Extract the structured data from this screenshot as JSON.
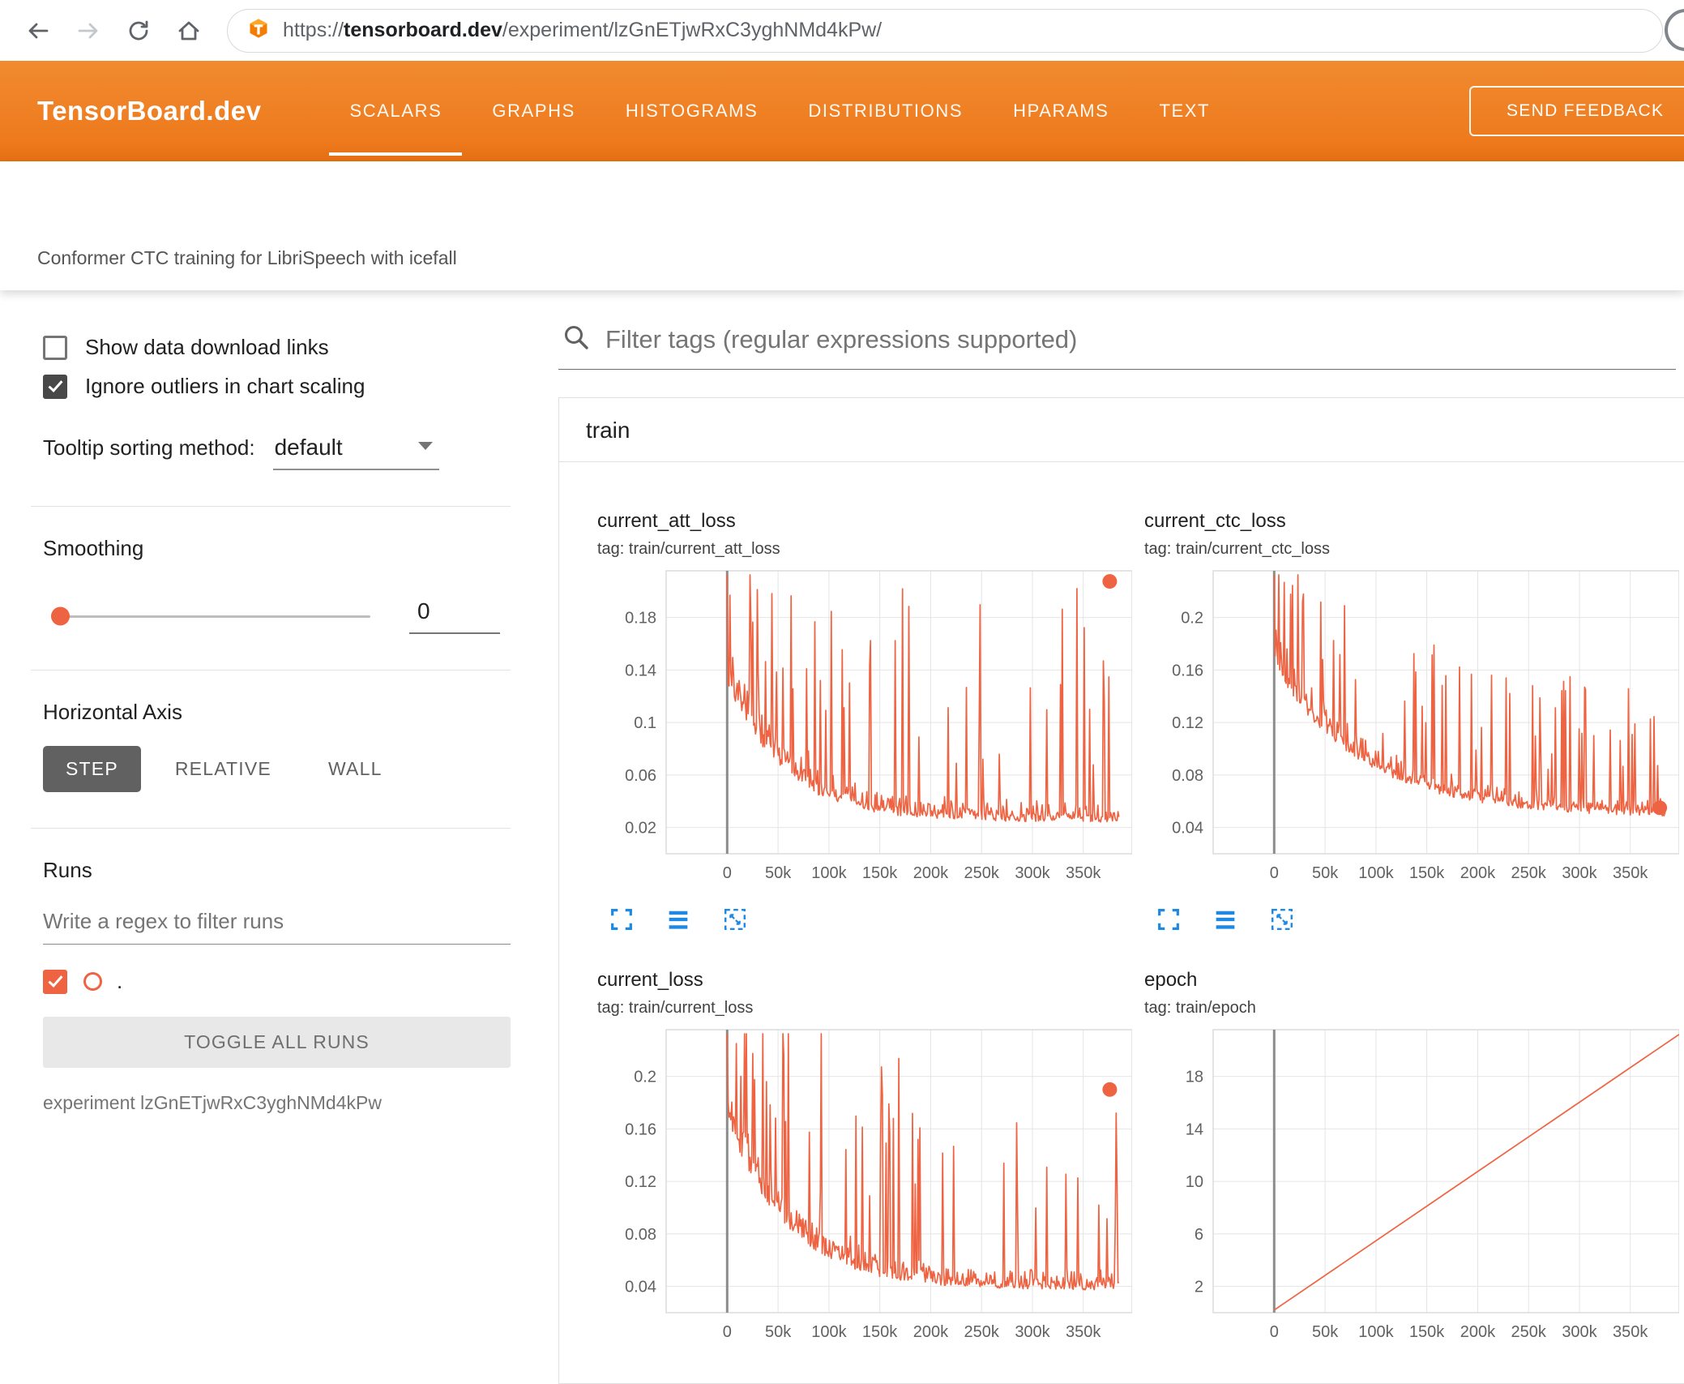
{
  "browser": {
    "url_scheme": "https://",
    "url_domain": "tensorboard.dev",
    "url_path": "/experiment/lzGnETjwRxC3yghNMd4kPw/"
  },
  "header": {
    "brand": "TensorBoard.dev",
    "tabs": [
      {
        "label": "SCALARS",
        "active": true
      },
      {
        "label": "GRAPHS",
        "active": false
      },
      {
        "label": "HISTOGRAMS",
        "active": false
      },
      {
        "label": "DISTRIBUTIONS",
        "active": false
      },
      {
        "label": "HPARAMS",
        "active": false
      },
      {
        "label": "TEXT",
        "active": false
      }
    ],
    "feedback_button": "SEND FEEDBACK"
  },
  "subheader": {
    "title": "Conformer CTC training for LibriSpeech with icefall"
  },
  "sidebar": {
    "checkboxes": [
      {
        "label": "Show data download links",
        "checked": false
      },
      {
        "label": "Ignore outliers in chart scaling",
        "checked": true
      }
    ],
    "tooltip_sorting": {
      "label": "Tooltip sorting method:",
      "value": "default"
    },
    "smoothing": {
      "label": "Smoothing",
      "value": "0"
    },
    "horizontal_axis": {
      "label": "Horizontal Axis",
      "options": [
        {
          "label": "STEP",
          "active": true
        },
        {
          "label": "RELATIVE",
          "active": false
        },
        {
          "label": "WALL",
          "active": false
        }
      ]
    },
    "runs": {
      "label": "Runs",
      "filter_placeholder": "Write a regex to filter runs",
      "run_item": {
        "name": ".",
        "checked": true
      },
      "toggle_button": "TOGGLE ALL RUNS",
      "experiment_label": "experiment lzGnETjwRxC3yghNMd4kPw"
    }
  },
  "main": {
    "filter_placeholder": "Filter tags (regular expressions supported)",
    "card_title": "train"
  },
  "colors": {
    "header_orange": "#ee7a1d",
    "header_orange_dark": "#e56f12",
    "run_color": "#ee6443",
    "icon_blue": "#1e88e5",
    "step_button_gray": "#616161"
  },
  "icons": {
    "back-icon": "left-arrow",
    "forward-icon": "right-arrow",
    "reload-icon": "circular-arrow",
    "home-icon": "house",
    "tensorboard-favicon-icon": "orange-cube-logo",
    "search-icon": "magnifier",
    "chevron-down-icon": "▾",
    "fullscreen-icon": "corner-brackets",
    "log-scale-icon": "three-lines",
    "fit-domain-icon": "dashed-box-arrows",
    "avatar": "partial-circle"
  },
  "chart_data": [
    {
      "id": "current_att_loss",
      "type": "line",
      "title": "current_att_loss",
      "subtitle": "tag: train/current_att_loss",
      "x_range": [
        -60000,
        398000
      ],
      "y_range": [
        0,
        0.2156
      ],
      "x_tick_values": [
        0,
        50000,
        100000,
        150000,
        200000,
        250000,
        300000,
        350000
      ],
      "x_tick_labels": [
        "0",
        "50k",
        "100k",
        "150k",
        "200k",
        "250k",
        "300k",
        "350k"
      ],
      "y_ticks": [
        0.02,
        0.06,
        0.1,
        0.14,
        0.18
      ],
      "y_tick_labels": [
        "0.02",
        "0.06",
        "0.1",
        "0.14",
        "0.18"
      ],
      "grid": true,
      "legend": "none",
      "toolbar": true,
      "series": [
        {
          "name": ".",
          "approx_trend": [
            [
              0,
              0.19
            ],
            [
              20000,
              0.13
            ],
            [
              50000,
              0.06
            ],
            [
              100000,
              0.04
            ],
            [
              150000,
              0.033
            ],
            [
              200000,
              0.03
            ],
            [
              250000,
              0.029
            ],
            [
              300000,
              0.028
            ],
            [
              380000,
              0.027
            ]
          ],
          "end_marker": [
            376000,
            0.2075
          ],
          "synthesis": {
            "seed": 11,
            "n": 430,
            "x0": 0,
            "x1": 385000,
            "base_start": 0.13,
            "base_end": 0.024,
            "base_tau": 55000,
            "noise_start": 0.05,
            "noise_end": 0.018,
            "noise_tau": 90000,
            "spike_prob": 0.1,
            "spike_boost": 2.0,
            "spike_min": 0.04,
            "spike_max": 0.17,
            "clip_min": 0.013,
            "clip_max": 0.2125
          }
        }
      ]
    },
    {
      "id": "current_ctc_loss",
      "type": "line",
      "title": "current_ctc_loss",
      "subtitle": "tag: train/current_ctc_loss",
      "x_range": [
        -60000,
        398000
      ],
      "y_range": [
        0.02,
        0.2356
      ],
      "x_tick_values": [
        0,
        50000,
        100000,
        150000,
        200000,
        250000,
        300000,
        350000
      ],
      "x_tick_labels": [
        "0",
        "50k",
        "100k",
        "150k",
        "200k",
        "250k",
        "300k",
        "350k"
      ],
      "y_ticks": [
        0.04,
        0.08,
        0.12,
        0.16,
        0.2
      ],
      "y_tick_labels": [
        "0.04",
        "0.08",
        "0.12",
        "0.16",
        "0.2"
      ],
      "grid": true,
      "legend": "none",
      "toolbar": true,
      "series": [
        {
          "name": ".",
          "approx_trend": [
            [
              0,
              0.2
            ],
            [
              30000,
              0.15
            ],
            [
              60000,
              0.11
            ],
            [
              100000,
              0.09
            ],
            [
              150000,
              0.075
            ],
            [
              200000,
              0.065
            ],
            [
              250000,
              0.06
            ],
            [
              300000,
              0.055
            ],
            [
              380000,
              0.05
            ]
          ],
          "end_marker": [
            379000,
            0.055
          ],
          "synthesis": {
            "seed": 23,
            "n": 430,
            "x0": 0,
            "x1": 385000,
            "base_start": 0.16,
            "base_end": 0.047,
            "base_tau": 90000,
            "noise_start": 0.04,
            "noise_end": 0.014,
            "noise_tau": 120000,
            "spike_prob": 0.09,
            "spike_boost": 1.5,
            "spike_min": 0.025,
            "spike_max": 0.1,
            "clip_min": 0.032,
            "clip_max": 0.2325
          }
        }
      ]
    },
    {
      "id": "current_loss",
      "type": "line",
      "title": "current_loss",
      "subtitle": "tag: train/current_loss",
      "x_range": [
        -60000,
        398000
      ],
      "y_range": [
        0.02,
        0.2356
      ],
      "x_tick_values": [
        0,
        50000,
        100000,
        150000,
        200000,
        250000,
        300000,
        350000
      ],
      "x_tick_labels": [
        "0",
        "50k",
        "100k",
        "150k",
        "200k",
        "250k",
        "300k",
        "350k"
      ],
      "y_ticks": [
        0.04,
        0.08,
        0.12,
        0.16,
        0.2
      ],
      "y_tick_labels": [
        "0.04",
        "0.08",
        "0.12",
        "0.16",
        "0.2"
      ],
      "grid": true,
      "legend": "none",
      "toolbar": false,
      "series": [
        {
          "name": ".",
          "approx_trend": [
            [
              0,
              0.2
            ],
            [
              20000,
              0.14
            ],
            [
              50000,
              0.08
            ],
            [
              100000,
              0.055
            ],
            [
              150000,
              0.045
            ],
            [
              200000,
              0.04
            ],
            [
              250000,
              0.04
            ],
            [
              300000,
              0.038
            ],
            [
              380000,
              0.037
            ]
          ],
          "end_marker": [
            376000,
            0.19
          ],
          "synthesis": {
            "seed": 37,
            "n": 430,
            "x0": 0,
            "x1": 385000,
            "base_start": 0.165,
            "base_end": 0.037,
            "base_tau": 60000,
            "noise_start": 0.05,
            "noise_end": 0.02,
            "noise_tau": 95000,
            "spike_prob": 0.1,
            "spike_boost": 2.0,
            "spike_min": 0.04,
            "spike_max": 0.16,
            "clip_min": 0.026,
            "clip_max": 0.2325
          }
        }
      ]
    },
    {
      "id": "epoch",
      "type": "line",
      "title": "epoch",
      "subtitle": "tag: train/epoch",
      "x_range": [
        -60000,
        398000
      ],
      "y_range": [
        0,
        21.56
      ],
      "x_tick_values": [
        0,
        50000,
        100000,
        150000,
        200000,
        250000,
        300000,
        350000
      ],
      "x_tick_labels": [
        "0",
        "50k",
        "100k",
        "150k",
        "200k",
        "250k",
        "300k",
        "350k"
      ],
      "y_ticks": [
        2,
        6,
        10,
        14,
        18
      ],
      "y_tick_labels": [
        "2",
        "6",
        "10",
        "14",
        "18"
      ],
      "grid": true,
      "legend": "none",
      "toolbar": false,
      "series": [
        {
          "name": ".",
          "points": [
            [
              0,
              0.2
            ],
            [
              398000,
              21.2
            ]
          ]
        }
      ]
    }
  ]
}
